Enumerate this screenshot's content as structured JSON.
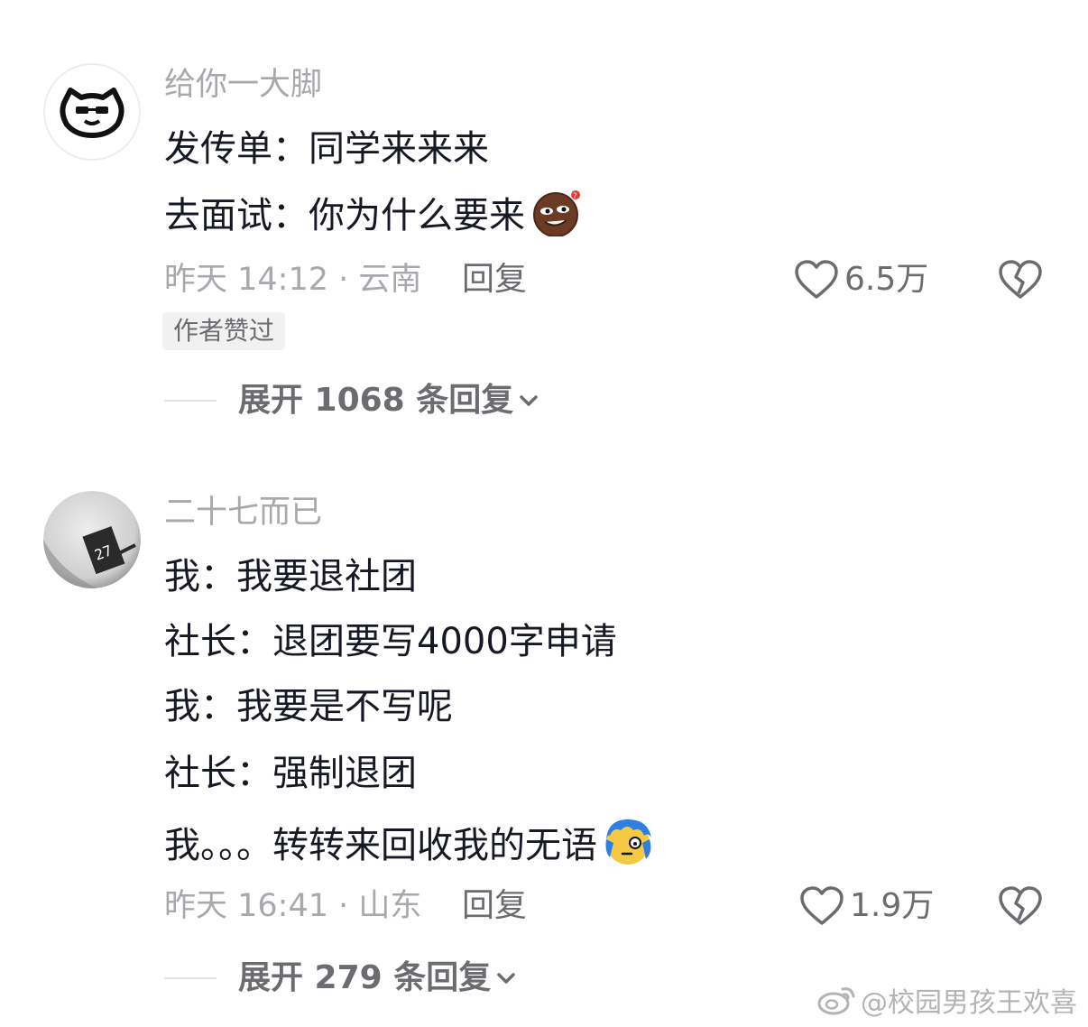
{
  "comments": [
    {
      "username": "给你一大脚",
      "lines": [
        "发传单：同学来来来",
        "去面试：你为什么要来"
      ],
      "emoji": "smirk-emoji",
      "meta": "昨天 14:12 · 云南",
      "reply_label": "回复",
      "likes": "6.5万",
      "author_liked": "作者赞过",
      "expand_label": "展开 1068 条回复"
    },
    {
      "username": "二十七而已",
      "lines": [
        "我：我要退社团",
        "社长：退团要写4000字申请",
        "我：我要是不写呢",
        "社长：强制退团",
        "我。。。转转来回收我的无语"
      ],
      "emoji": "speechless-emoji",
      "meta": "昨天 16:41 · 山东",
      "reply_label": "回复",
      "likes": "1.9万",
      "expand_label": "展开 279 条回复"
    }
  ],
  "watermark": "@校园男孩王欢喜",
  "icons": {
    "like": "heart-outline-icon",
    "dislike": "broken-heart-icon",
    "expand": "chevron-down-icon",
    "watermark": "weibo-logo-icon"
  },
  "colors": {
    "primary_text": "#161823",
    "secondary_text": "#a8a8ad",
    "action_text": "#6b6b70",
    "badge_bg": "#f1f1f2"
  }
}
